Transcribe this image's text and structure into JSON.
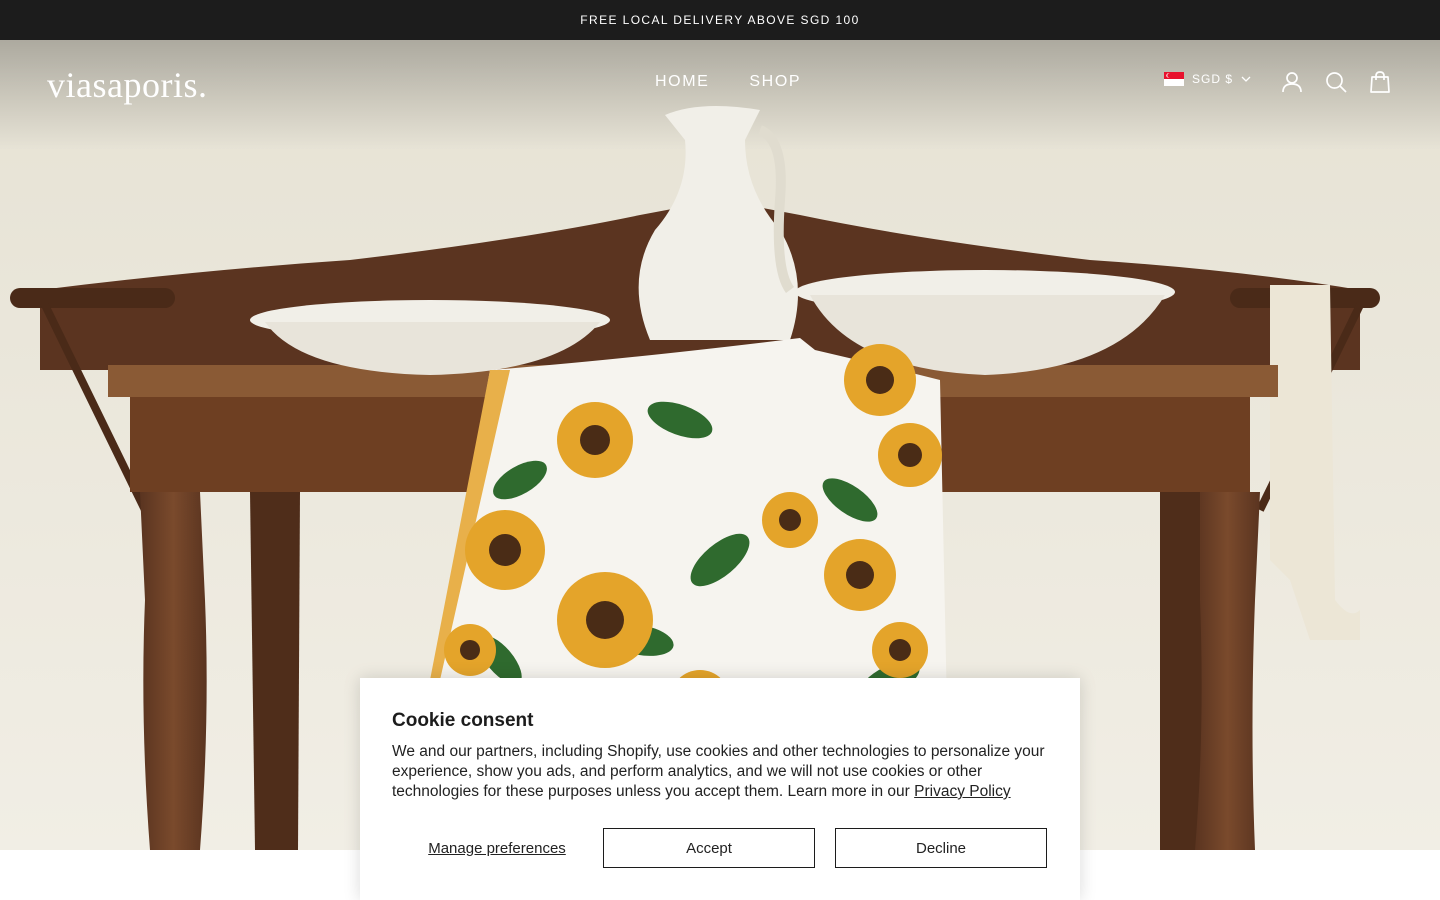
{
  "announcement": "FREE LOCAL DELIVERY ABOVE SGD 100",
  "logo": "viasaporis.",
  "nav": [
    "HOME",
    "SHOP"
  ],
  "currency": "SGD $",
  "icons": {
    "flag": "singapore-flag-icon",
    "chevron": "chevron-down-icon",
    "account": "account-icon",
    "search": "search-icon",
    "cart": "bag-icon"
  },
  "cookie": {
    "title": "Cookie consent",
    "body": "We and our partners, including Shopify, use cookies and other technologies to personalize your experience, show you ads, and perform analytics, and we will not use cookies or other technologies for these purposes unless you accept them. Learn more in our ",
    "privacy_link": "Privacy Policy",
    "manage": "Manage preferences",
    "accept": "Accept",
    "decline": "Decline"
  },
  "colors": {
    "announcement_bg": "#1c1c1c",
    "text_light": "#ffffff",
    "wood": "#6b3f24",
    "wall": "#ede9dd",
    "sunflower": "#e4a42a"
  }
}
